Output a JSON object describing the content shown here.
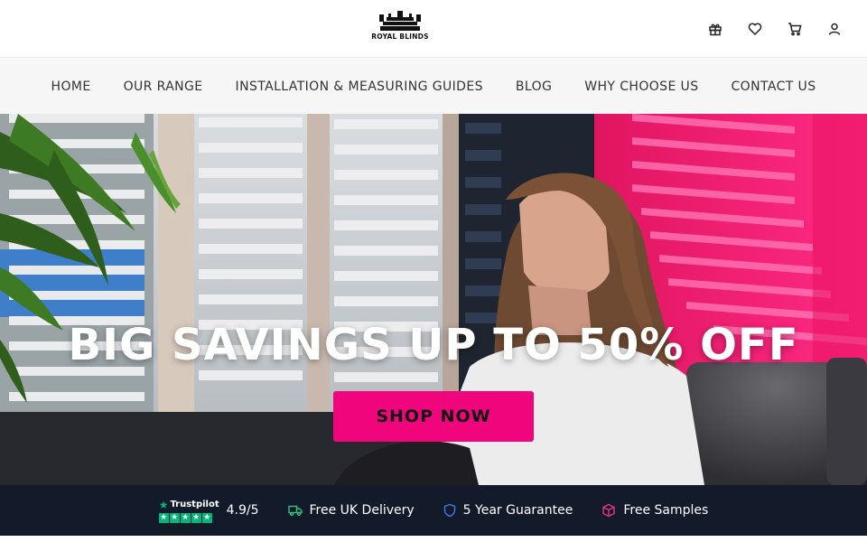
{
  "brand": {
    "name": "ROYAL BLINDS"
  },
  "header_icons": [
    {
      "name": "gift-icon"
    },
    {
      "name": "heart-icon"
    },
    {
      "name": "cart-icon"
    },
    {
      "name": "user-icon"
    }
  ],
  "nav": {
    "items": [
      {
        "label": "HOME"
      },
      {
        "label": "OUR RANGE"
      },
      {
        "label": "INSTALLATION & MEASURING GUIDES"
      },
      {
        "label": "BLOG"
      },
      {
        "label": "WHY CHOOSE US"
      },
      {
        "label": "CONTACT US"
      }
    ]
  },
  "hero": {
    "heading": "BIG SAVINGS UP TO 50% OFF",
    "cta_label": "SHOP NOW"
  },
  "trust": {
    "trustpilot_label": "Trustpilot",
    "rating": "4.9/5",
    "delivery": "Free UK Delivery",
    "guarantee": "5 Year Guarantee",
    "samples": "Free Samples"
  },
  "colors": {
    "accent": "#f0057d",
    "trust_bar": "#131b2b",
    "trustpilot_green": "#00b67a",
    "delivery_icon": "#35c27a",
    "guarantee_icon": "#3f7cf0",
    "samples_icon": "#e8328a"
  }
}
